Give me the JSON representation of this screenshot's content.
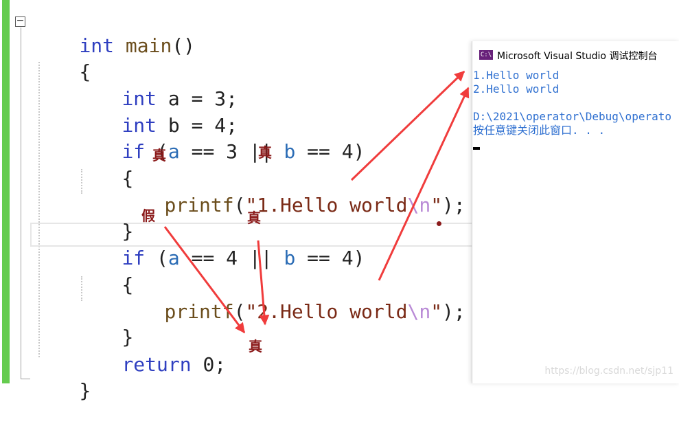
{
  "editor": {
    "lines": {
      "l1": {
        "kw": "int",
        "name": " main",
        "rest": "()"
      },
      "l2": {
        "text": "{"
      },
      "l3": {
        "kw": "int",
        "rest": " a = 3;"
      },
      "l4": {
        "kw": "int",
        "rest": " b = 4;"
      },
      "l5": {
        "kw": "if",
        "p1": " (",
        "a": "a",
        "m1": " == 3 || ",
        "b": "b",
        "m2": " == 4)"
      },
      "l6": {
        "text": "{"
      },
      "l7": {
        "fn": "printf",
        "p": "(",
        "str": "\"1.Hello world",
        "esc": "\\n",
        "q": "\"",
        "end": ");"
      },
      "l8": {
        "text": "}"
      },
      "l9": {
        "kw": "if",
        "p1": " (",
        "a": "a",
        "m1": " == 4 || ",
        "b": "b",
        "m2": " == 4)"
      },
      "l10": {
        "text": "{"
      },
      "l11": {
        "fn": "printf",
        "p": "(",
        "str": "\"2.Hello world",
        "esc": "\\n",
        "q": "\"",
        "end": ");"
      },
      "l12": {
        "text": "}"
      },
      "l13": {
        "kw": "return",
        "rest": " 0;"
      },
      "l14": {
        "text": "}"
      }
    },
    "collapse_glyph": "−"
  },
  "annotations": {
    "true_label": "真",
    "false_label": "假"
  },
  "console": {
    "title": "Microsoft Visual Studio 调试控制台",
    "icon_text": "C:\\",
    "output": [
      "1.Hello world",
      "2.Hello world",
      "",
      "D:\\2021\\operator\\Debug\\operato",
      "按任意键关闭此窗口. . ."
    ]
  },
  "watermark": "https://blog.csdn.net/sjp11",
  "colors": {
    "keyword": "#2f3fc0",
    "variable": "#2b6cb5",
    "function": "#6b4d1c",
    "string": "#7a2a16",
    "escape": "#b98ad6",
    "annotation": "#8b1a1a",
    "arrow": "#f03c3c",
    "change_bar": "#65cc4f",
    "console_text": "#2e6fd0"
  }
}
